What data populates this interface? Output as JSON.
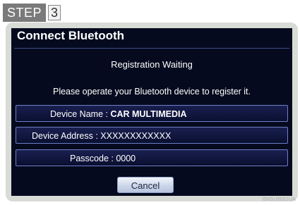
{
  "step": {
    "label": "STEP",
    "number": "3"
  },
  "dialog": {
    "title": "Connect Bluetooth",
    "status": "Registration Waiting",
    "instruction": "Please operate your Bluetooth device to register it.",
    "device_name": {
      "label": "Device Name : ",
      "value": "CAR MULTIMEDIA"
    },
    "device_address": {
      "label": "Device Address : ",
      "value": "XXXXXXXXXXXX"
    },
    "passcode": {
      "label": "Passcode : ",
      "value": "0000"
    },
    "cancel_label": "Cancel"
  },
  "watermark": "I55GU5002UA",
  "colors": {
    "screen_background": "#050a1e",
    "row_border": "#6d7fc8",
    "button_face": "#ccd6ea",
    "frame": "#d9dbd6"
  }
}
